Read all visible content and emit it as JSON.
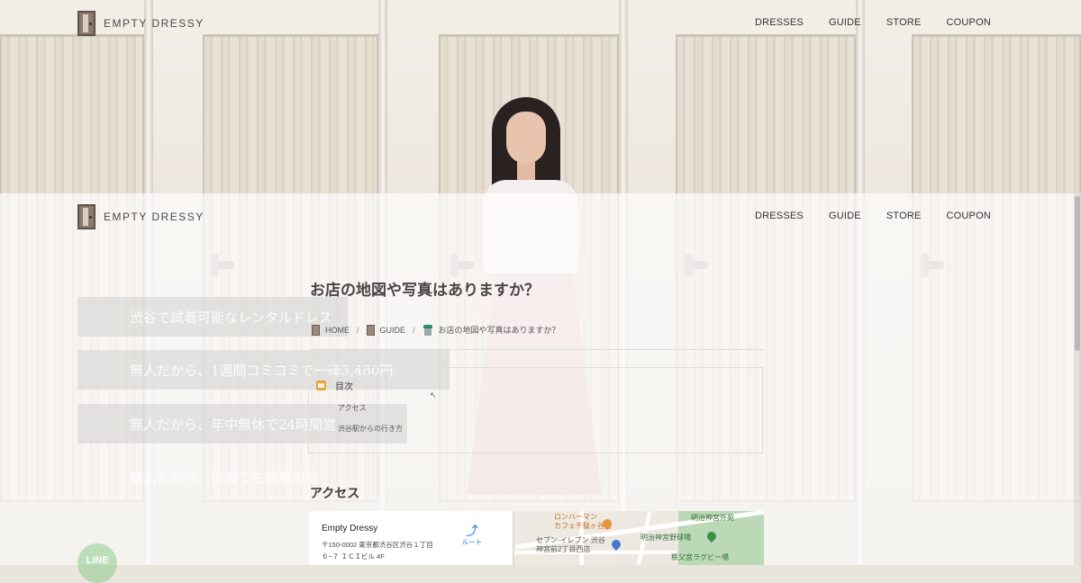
{
  "site": {
    "logo_text": "EMPTY DRESSY"
  },
  "nav": [
    {
      "label": "DRESSES"
    },
    {
      "label": "GUIDE"
    },
    {
      "label": "STORE"
    },
    {
      "label": "COUPON"
    }
  ],
  "promos": [
    "渋谷で試着可能なレンタルドレス",
    "無人だから、1週間コミコミで一律3,480円",
    "無人だから、年中無休で24時間営",
    "無人だから、何度でも試着可能"
  ],
  "article": {
    "title": "お店の地図や写真はありますか？",
    "breadcrumb": [
      "HOME",
      "GUIDE",
      "お店の地図や写真はありますか？"
    ],
    "toc": {
      "heading": "目次",
      "items": [
        "アクセス",
        "渋谷駅からの行き方"
      ]
    },
    "section_title": "アクセス"
  },
  "map": {
    "place_name": "Empty Dressy",
    "address_line1": "〒150-0002 東京都渋谷区渋谷１丁目",
    "address_line2": "６−７ ＩＣＩビル 4F",
    "route_label": "ルート",
    "labels": {
      "cafe": "ロンハーマン\nカフェ千駄ヶ谷店",
      "seven": "セブン-イレブン 渋谷\n神宮前2丁目西店",
      "gaien": "明治神宮外苑",
      "stadium": "明治神宮野球場",
      "rugby": "秩父宮ラグビー場"
    }
  },
  "line_button": {
    "label": "LINE"
  },
  "colors": {
    "route_blue": "#1a73e8",
    "park_green": "#bcd9b7",
    "line_green": "#06c755"
  }
}
